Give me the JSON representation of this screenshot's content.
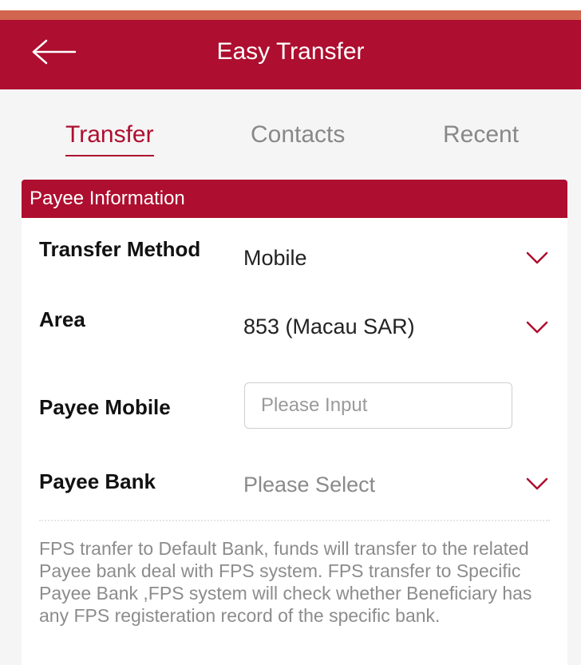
{
  "header": {
    "title": "Easy Transfer",
    "back_icon": "arrow-left-icon"
  },
  "colors": {
    "brand": "#ae0e2f",
    "status_bar": "#d1654f",
    "background": "#f5f5f5",
    "inactive_tab": "#888888",
    "muted_text": "#8c8c8c"
  },
  "tabs": [
    {
      "label": "Transfer",
      "active": true
    },
    {
      "label": "Contacts",
      "active": false
    },
    {
      "label": "Recent",
      "active": false
    }
  ],
  "payee_section": {
    "title": "Payee Information",
    "transfer_method": {
      "label": "Transfer Method",
      "value": "Mobile",
      "icon": "chevron-down-icon"
    },
    "area": {
      "label": "Area",
      "value": "853 (Macau SAR)",
      "icon": "chevron-down-icon"
    },
    "payee_mobile": {
      "label": "Payee Mobile",
      "value": "",
      "placeholder": "Please Input"
    },
    "payee_bank": {
      "label": "Payee Bank",
      "placeholder": "Please Select",
      "icon": "chevron-down-icon"
    },
    "note": "FPS tranfer to Default Bank, funds will transfer to the related Payee bank deal with FPS system. FPS transfer to Specific Payee Bank ,FPS system will check whether Beneficiary has any FPS registeration record of the specific bank."
  }
}
